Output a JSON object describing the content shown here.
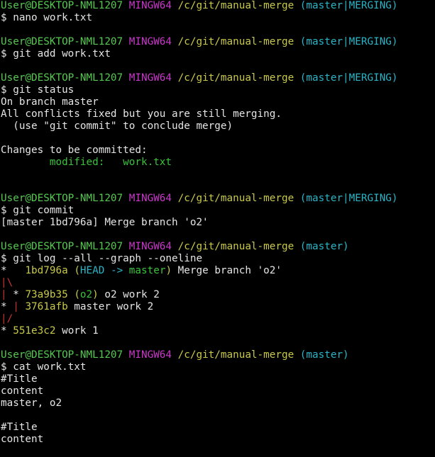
{
  "colors": {
    "background": "#000000",
    "text": "#e5e5e5",
    "user": "#55c850",
    "host": "#c838c8",
    "path": "#c8c84a",
    "branch": "#2ab5c7",
    "modified": "#3cc23c",
    "graph_red": "#c83232",
    "graph_lime": "#8acb3e"
  },
  "lines": [
    {
      "segs": [
        {
          "t": "User@DESKTOP-NML1207",
          "c": "user"
        },
        {
          "t": " "
        },
        {
          "t": "MINGW64",
          "c": "host"
        },
        {
          "t": " "
        },
        {
          "t": "/c/git/manual-merge",
          "c": "path"
        },
        {
          "t": " "
        },
        {
          "t": "(master|MERGING)",
          "c": "branch"
        }
      ]
    },
    {
      "segs": [
        {
          "t": "$ nano work.txt"
        }
      ]
    },
    {
      "segs": []
    },
    {
      "segs": [
        {
          "t": "User@DESKTOP-NML1207",
          "c": "user"
        },
        {
          "t": " "
        },
        {
          "t": "MINGW64",
          "c": "host"
        },
        {
          "t": " "
        },
        {
          "t": "/c/git/manual-merge",
          "c": "path"
        },
        {
          "t": " "
        },
        {
          "t": "(master|MERGING)",
          "c": "branch"
        }
      ]
    },
    {
      "segs": [
        {
          "t": "$ git add work.txt"
        }
      ]
    },
    {
      "segs": []
    },
    {
      "segs": [
        {
          "t": "User@DESKTOP-NML1207",
          "c": "user"
        },
        {
          "t": " "
        },
        {
          "t": "MINGW64",
          "c": "host"
        },
        {
          "t": " "
        },
        {
          "t": "/c/git/manual-merge",
          "c": "path"
        },
        {
          "t": " "
        },
        {
          "t": "(master|MERGING)",
          "c": "branch"
        }
      ]
    },
    {
      "segs": [
        {
          "t": "$ git status"
        }
      ]
    },
    {
      "segs": [
        {
          "t": "On branch master"
        }
      ]
    },
    {
      "segs": [
        {
          "t": "All conflicts fixed but you are still merging."
        }
      ]
    },
    {
      "segs": [
        {
          "t": "  (use \"git commit\" to conclude merge)"
        }
      ]
    },
    {
      "segs": []
    },
    {
      "segs": [
        {
          "t": "Changes to be committed:"
        }
      ]
    },
    {
      "segs": [
        {
          "t": "        "
        },
        {
          "t": "modified:   work.txt",
          "c": "green"
        }
      ]
    },
    {
      "segs": []
    },
    {
      "segs": []
    },
    {
      "segs": [
        {
          "t": "User@DESKTOP-NML1207",
          "c": "user"
        },
        {
          "t": " "
        },
        {
          "t": "MINGW64",
          "c": "host"
        },
        {
          "t": " "
        },
        {
          "t": "/c/git/manual-merge",
          "c": "path"
        },
        {
          "t": " "
        },
        {
          "t": "(master|MERGING)",
          "c": "branch"
        }
      ]
    },
    {
      "segs": [
        {
          "t": "$ git commit"
        }
      ]
    },
    {
      "segs": [
        {
          "t": "[master 1bd796a] Merge branch 'o2'"
        }
      ]
    },
    {
      "segs": []
    },
    {
      "segs": [
        {
          "t": "User@DESKTOP-NML1207",
          "c": "user"
        },
        {
          "t": " "
        },
        {
          "t": "MINGW64",
          "c": "host"
        },
        {
          "t": " "
        },
        {
          "t": "/c/git/manual-merge",
          "c": "path"
        },
        {
          "t": " "
        },
        {
          "t": "(master)",
          "c": "branch"
        }
      ]
    },
    {
      "segs": [
        {
          "t": "$ git log --all --graph --oneline"
        }
      ]
    },
    {
      "segs": [
        {
          "t": "*   "
        },
        {
          "t": "1bd796a",
          "c": "yellow"
        },
        {
          "t": " "
        },
        {
          "t": "(",
          "c": "yellow"
        },
        {
          "t": "HEAD -> ",
          "c": "cyan"
        },
        {
          "t": "master",
          "c": "green"
        },
        {
          "t": ")",
          "c": "yellow"
        },
        {
          "t": " Merge branch 'o2'"
        }
      ]
    },
    {
      "segs": [
        {
          "t": "|\\",
          "c": "red"
        }
      ]
    },
    {
      "segs": [
        {
          "t": "|",
          "c": "red"
        },
        {
          "t": " * "
        },
        {
          "t": "73a9b35",
          "c": "yellow"
        },
        {
          "t": " "
        },
        {
          "t": "(",
          "c": "yellow"
        },
        {
          "t": "o2",
          "c": "green"
        },
        {
          "t": ")",
          "c": "yellow"
        },
        {
          "t": " o2 work 2"
        }
      ]
    },
    {
      "segs": [
        {
          "t": "* "
        },
        {
          "t": "|",
          "c": "red"
        },
        {
          "t": " "
        },
        {
          "t": "3761afb",
          "c": "yellow"
        },
        {
          "t": " master work 2"
        }
      ]
    },
    {
      "segs": [
        {
          "t": "|/",
          "c": "red"
        }
      ]
    },
    {
      "segs": [
        {
          "t": "* "
        },
        {
          "t": "551e3c2",
          "c": "yellow"
        },
        {
          "t": " work 1"
        }
      ]
    },
    {
      "segs": []
    },
    {
      "segs": [
        {
          "t": "User@DESKTOP-NML1207",
          "c": "user"
        },
        {
          "t": " "
        },
        {
          "t": "MINGW64",
          "c": "host"
        },
        {
          "t": " "
        },
        {
          "t": "/c/git/manual-merge",
          "c": "path"
        },
        {
          "t": " "
        },
        {
          "t": "(master)",
          "c": "branch"
        }
      ]
    },
    {
      "segs": [
        {
          "t": "$ cat work.txt"
        }
      ]
    },
    {
      "segs": [
        {
          "t": "#Title"
        }
      ]
    },
    {
      "segs": [
        {
          "t": "content"
        }
      ]
    },
    {
      "segs": [
        {
          "t": "master, o2"
        }
      ]
    },
    {
      "segs": []
    },
    {
      "segs": [
        {
          "t": "#Title"
        }
      ]
    },
    {
      "segs": [
        {
          "t": "content"
        }
      ]
    }
  ]
}
